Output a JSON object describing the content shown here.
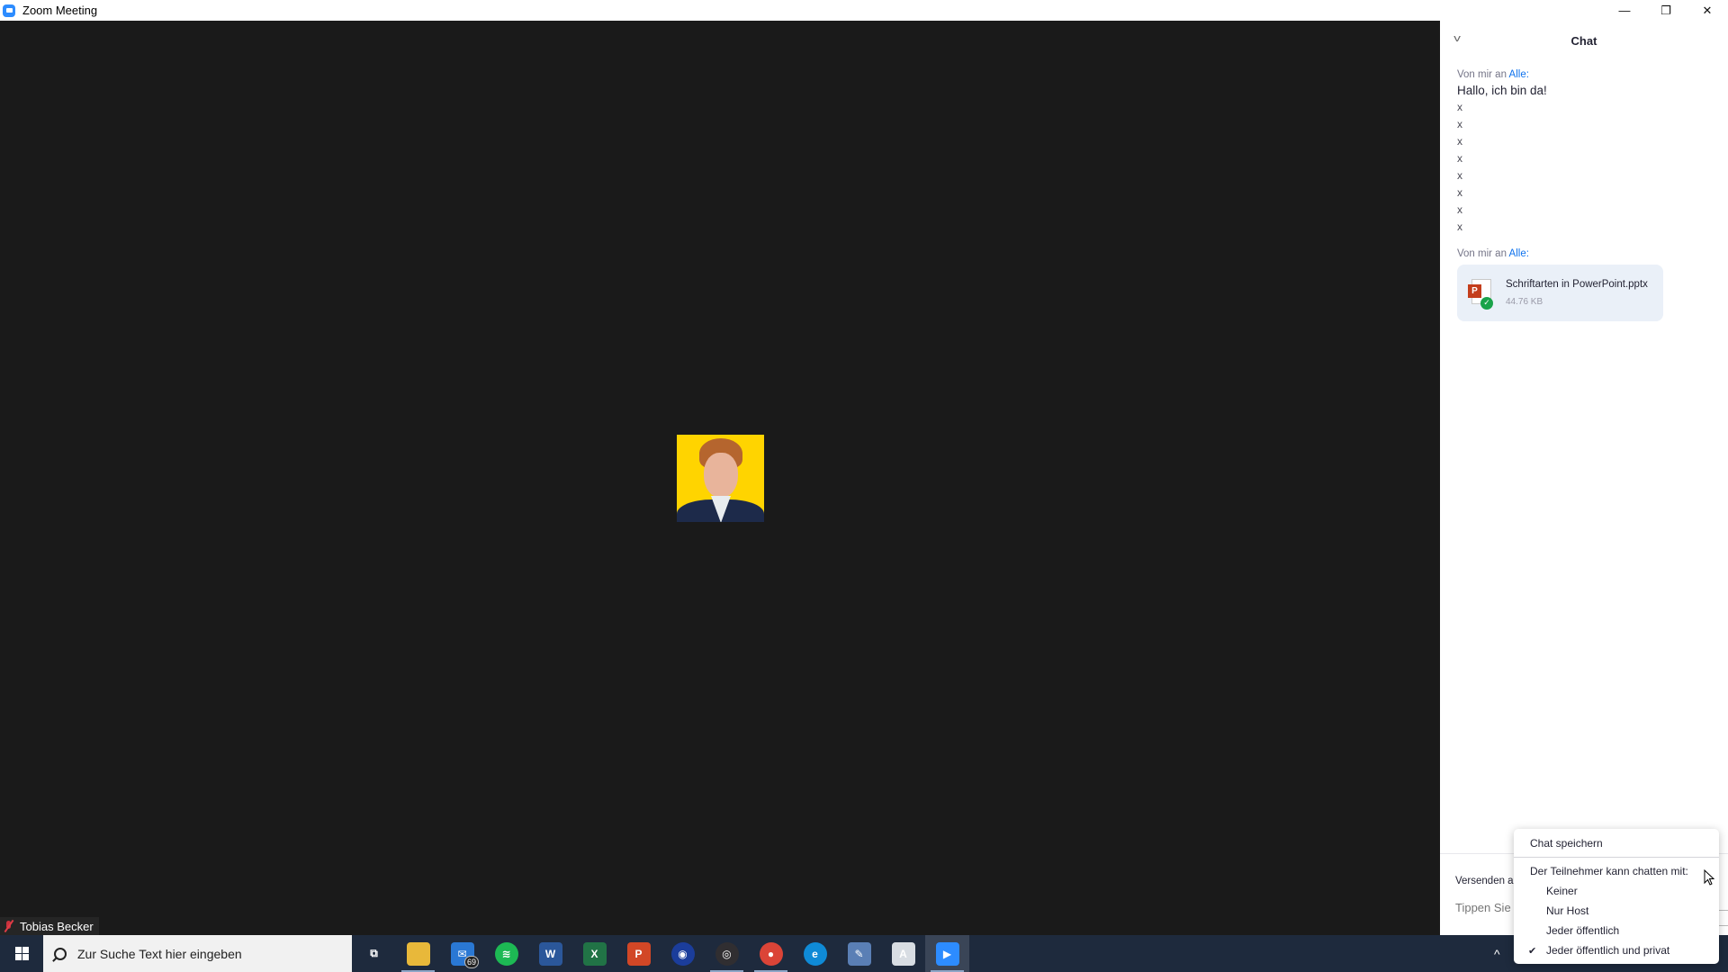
{
  "window": {
    "title": "Zoom Meeting",
    "controls": {
      "minimize": "—",
      "restore": "❐",
      "close": "✕"
    }
  },
  "video": {
    "participant_name": "Tobias Becker",
    "mic_status": "muted",
    "avatar_bg_color": "#ffd400"
  },
  "chat": {
    "title": "Chat",
    "collapse_icon": "chevron-down-icon",
    "messages": [
      {
        "meta_prefix": "Von mir an",
        "recipient": "Alle:",
        "lines": [
          "Hallo, ich bin da!",
          "x",
          "x",
          "x",
          "x",
          "x",
          "x",
          "x",
          "x"
        ]
      },
      {
        "meta_prefix": "Von mir an",
        "recipient": "Alle:",
        "file": {
          "name": "Schriftarten in PowerPoint.pptx",
          "size": "44.76 KB",
          "type_letter": "P"
        }
      }
    ],
    "footer": {
      "send_to_label": "Versenden an:",
      "input_placeholder": "Tippen Sie hier Ihre Nachricht ein..."
    }
  },
  "context_menu": {
    "save_chat": "Chat speichern",
    "permission_label": "Der Teilnehmer kann chatten mit:",
    "options": [
      {
        "label": "Keiner",
        "checked": false
      },
      {
        "label": "Nur Host",
        "checked": false
      },
      {
        "label": "Jeder öffentlich",
        "checked": false
      },
      {
        "label": "Jeder öffentlich und privat",
        "checked": true
      }
    ],
    "check_glyph": "✔"
  },
  "taskbar": {
    "search_placeholder": "Zur Suche Text hier eingeben",
    "apps": [
      {
        "name": "task-view",
        "glyph": "⧉",
        "color": "transparent"
      },
      {
        "name": "file-explorer",
        "glyph": "",
        "color": "#e8b83a"
      },
      {
        "name": "mail",
        "glyph": "✉",
        "color": "#2a78d4",
        "badge": "69"
      },
      {
        "name": "spotify",
        "glyph": "≋",
        "color": "#1db954"
      },
      {
        "name": "word",
        "glyph": "W",
        "color": "#2b579a"
      },
      {
        "name": "excel",
        "glyph": "X",
        "color": "#217346"
      },
      {
        "name": "powerpoint",
        "glyph": "P",
        "color": "#d24726"
      },
      {
        "name": "audacity",
        "glyph": "◉",
        "color": "#1b3d9b"
      },
      {
        "name": "obs",
        "glyph": "◎",
        "color": "#302e31"
      },
      {
        "name": "chrome",
        "glyph": "●",
        "color": "#db4437"
      },
      {
        "name": "edge",
        "glyph": "e",
        "color": "#0f8ad6"
      },
      {
        "name": "paint-app",
        "glyph": "✎",
        "color": "#5a7fb5"
      },
      {
        "name": "notepad-app",
        "glyph": "A",
        "color": "#d8dde3"
      },
      {
        "name": "zoom",
        "glyph": "▶",
        "color": "#2d8cff"
      }
    ],
    "tray_chevron": "^"
  }
}
